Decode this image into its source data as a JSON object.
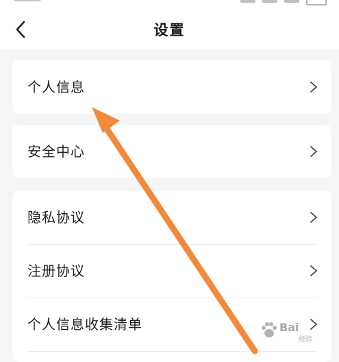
{
  "header": {
    "title": "设置",
    "back_icon": "chevron-left-icon"
  },
  "groups": [
    {
      "items": [
        {
          "label": "个人信息",
          "icon": "chevron-right-icon"
        }
      ]
    },
    {
      "items": [
        {
          "label": "安全中心",
          "icon": "chevron-right-icon"
        }
      ]
    },
    {
      "items": [
        {
          "label": "隐私协议",
          "icon": "chevron-right-icon"
        },
        {
          "label": "注册协议",
          "icon": "chevron-right-icon"
        },
        {
          "label": "个人信息收集清单",
          "icon": "chevron-right-icon"
        }
      ]
    }
  ],
  "annotation": {
    "arrow_color": "#f08a3c",
    "points_to": "个人信息"
  },
  "watermark": {
    "logo_text": "Bai",
    "sub_text": "经验"
  },
  "colors": {
    "page_background": "#f5f5f5",
    "card_background": "#ffffff",
    "text": "#222222"
  }
}
